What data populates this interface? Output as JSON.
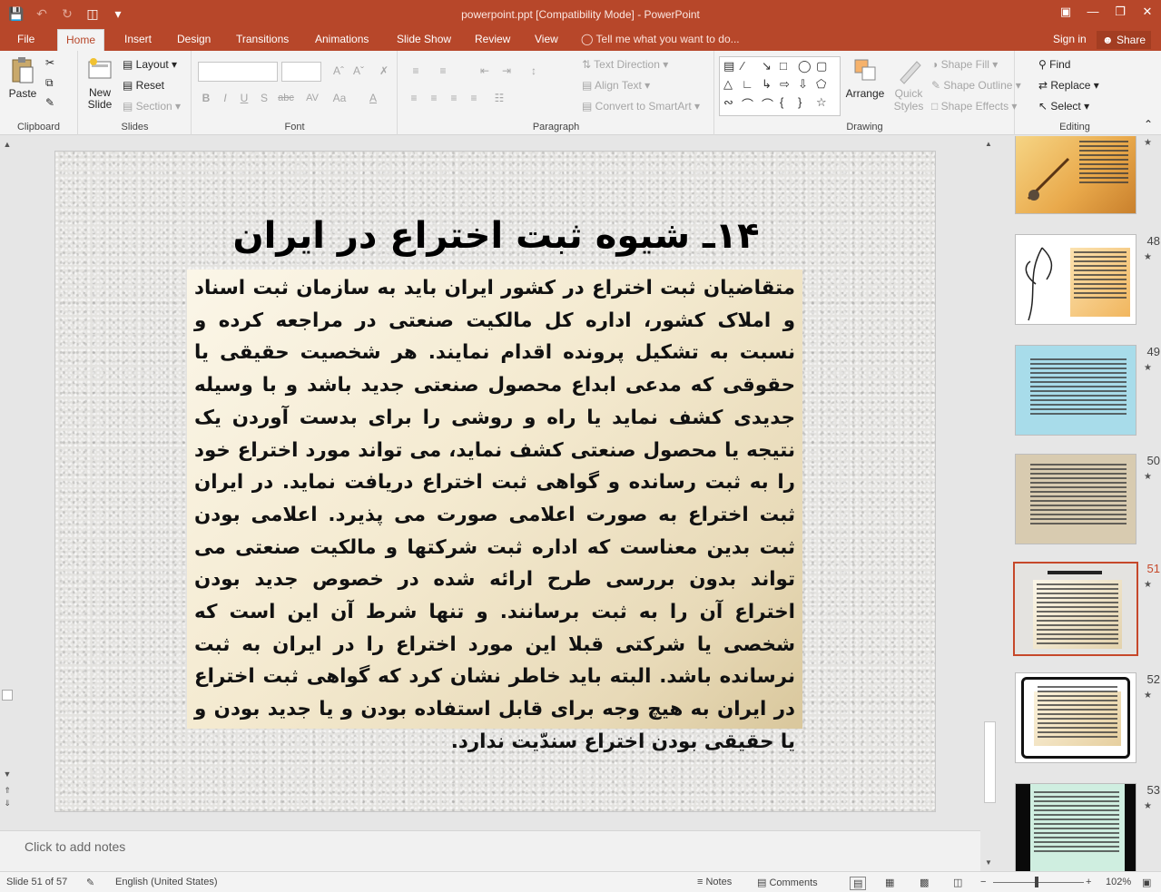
{
  "titlebar": {
    "title": "powerpoint.ppt [Compatibility Mode] - PowerPoint",
    "qat_icons": [
      "save-icon",
      "undo-icon",
      "redo-icon",
      "present-icon",
      "customize-icon"
    ],
    "window_icons": [
      "ribbon-options-icon",
      "minimize-icon",
      "restore-icon",
      "close-icon"
    ]
  },
  "tabs": [
    "File",
    "Home",
    "Insert",
    "Design",
    "Transitions",
    "Animations",
    "Slide Show",
    "Review",
    "View"
  ],
  "active_tab": "Home",
  "tell_me": "Tell me what you want to do...",
  "signin": "Sign in",
  "share": "Share",
  "ribbon": {
    "clipboard": {
      "label": "Clipboard",
      "paste": "Paste"
    },
    "slides": {
      "label": "Slides",
      "new_slide": "New Slide",
      "layout": "Layout",
      "reset": "Reset",
      "section": "Section"
    },
    "font": {
      "label": "Font",
      "bold": "B",
      "italic": "I",
      "underline": "U",
      "shadow": "S",
      "strike": "abc",
      "spacing": "AV",
      "case": "Aa",
      "color": "A"
    },
    "paragraph": {
      "label": "Paragraph",
      "text_direction": "Text Direction",
      "align_text": "Align Text",
      "convert_smartart": "Convert to SmartArt"
    },
    "drawing": {
      "label": "Drawing",
      "arrange": "Arrange",
      "quick_styles": "Quick Styles",
      "shape_fill": "Shape Fill",
      "shape_outline": "Shape Outline",
      "shape_effects": "Shape Effects"
    },
    "editing": {
      "label": "Editing",
      "find": "Find",
      "replace": "Replace",
      "select": "Select"
    }
  },
  "slide": {
    "title": "۱۴ـ شیوه ثبت اختراع در ایران",
    "body": "متقاضیان ثبت اختراع در کشور ایران باید به سازمان ثبت اسناد و املاک کشور، اداره کل مالکیت صنعتی در مراجعه کرده و نسبت به تشکیل پرونده اقدام نمایند. هر شخصیت حقیقی یا حقوقی که مدعی ابداع محصول صنعتی جدید باشد و با وسیله جدیدی کشف نماید یا راه و روشی را برای بدست آوردن یک نتیجه یا محصول صنعتی کشف نماید، می تواند مورد اختراع خود را به ثبت رسانده و گواهی ثبت اختراع دریافت نماید. در ایران ثبت اختراع به صورت اعلامی صورت می پذیرد. اعلامی بودن ثبت بدین معناست که اداره ثبت شرکتها و مالکیت صنعتی می تواند بدون بررسی طرح ارائه شده در خصوص جدید بودن اختراع آن را به ثبت برسانند. و تنها شرط آن این است که شخصی یا شرکتی قبلا این مورد اختراع را در ایران به ثبت نرسانده باشد. البته باید خاطر نشان کرد که گواهی ثبت اختراع در ایران به هیچ وجه برای قابل استفاده بودن و یا جدید بودن و یا حقیقی بودن اختراع سندّیت ندارد."
  },
  "thumbnails": [
    {
      "num": "",
      "style": "sepia"
    },
    {
      "num": "48",
      "style": "lily"
    },
    {
      "num": "49",
      "style": "blue"
    },
    {
      "num": "50",
      "style": "stone"
    },
    {
      "num": "51",
      "style": "active"
    },
    {
      "num": "52",
      "style": "frame"
    },
    {
      "num": "53",
      "style": "dark"
    }
  ],
  "notes_placeholder": "Click to add notes",
  "status": {
    "slide": "Slide 51 of 57",
    "language": "English (United States)",
    "notes": "Notes",
    "comments": "Comments",
    "zoom": "102%"
  }
}
